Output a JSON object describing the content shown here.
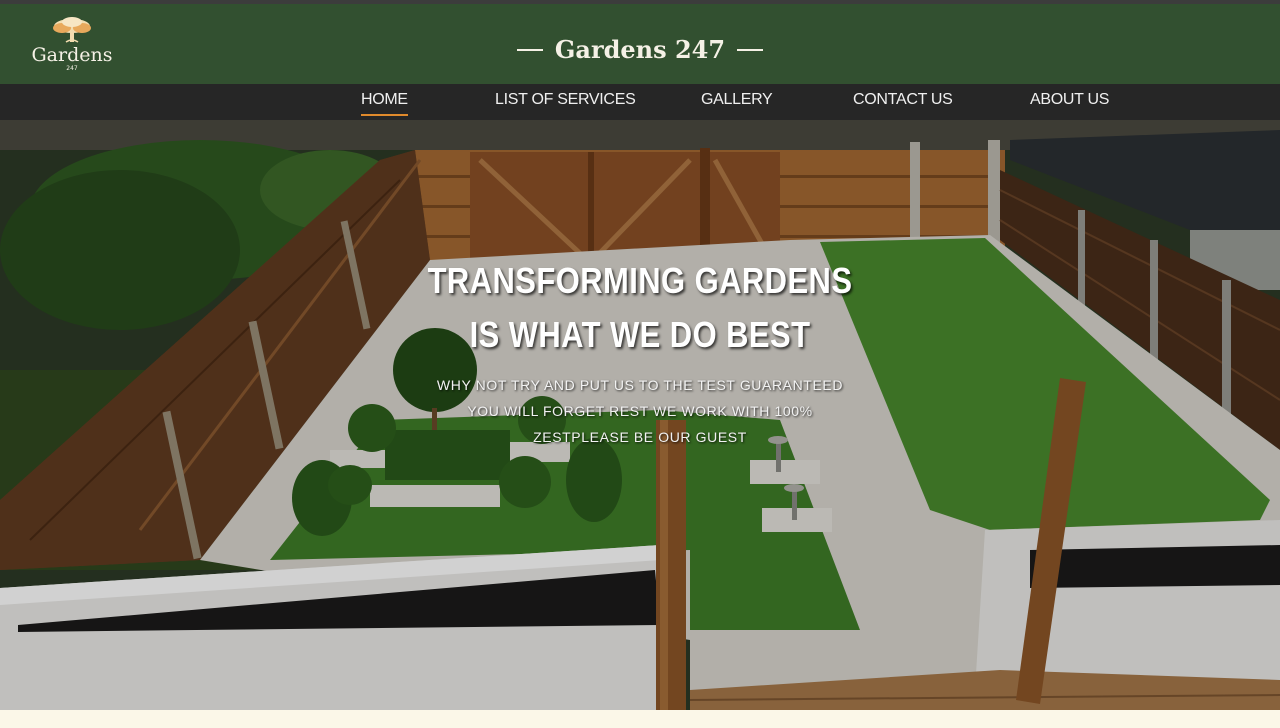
{
  "site": {
    "title": "Gardens 247",
    "logo_text": "Gardens",
    "logo_sub": "247"
  },
  "nav": {
    "items": [
      {
        "label": "HOME",
        "active": true
      },
      {
        "label": "LIST OF SERVICES",
        "active": false
      },
      {
        "label": "GALLERY",
        "active": false
      },
      {
        "label": "CONTACT US",
        "active": false
      },
      {
        "label": "ABOUT US",
        "active": false
      }
    ]
  },
  "hero": {
    "headline_line1": "TRANSFORMING GARDENS",
    "headline_line2": "IS WHAT WE DO BEST",
    "subtext": "WHY NOT TRY AND PUT US TO THE TEST GUARANTEED YOU WILL FORGET REST WE WORK WITH 100% ZESTPLEASE BE OUR GUEST"
  },
  "colors": {
    "header_bg": "#325030",
    "nav_bg": "#262626",
    "accent": "#e08a2c"
  },
  "icons": {
    "logo": "tree-logo-icon"
  }
}
